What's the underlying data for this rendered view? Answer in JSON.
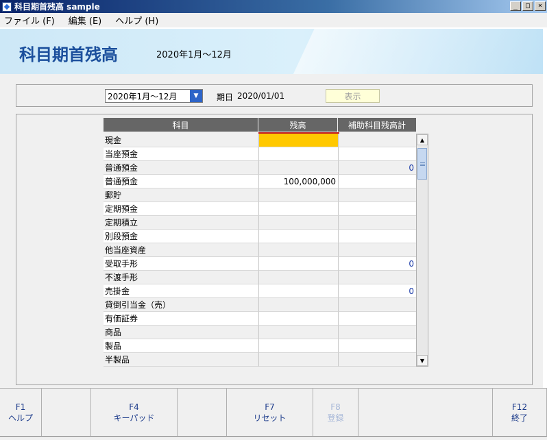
{
  "window": {
    "title": "科目期首残高 sample",
    "buttons": [
      "_",
      "□",
      "×"
    ]
  },
  "menu": [
    {
      "label": "ファイル (F)"
    },
    {
      "label": "編集 (E)"
    },
    {
      "label": "ヘルプ (H)"
    }
  ],
  "header": {
    "title": "科目期首残高",
    "period": "2020年1月〜12月"
  },
  "filter": {
    "period_select": "2020年1月〜12月",
    "start_label": "期日",
    "start_date": "2020/01/01",
    "show_button": "表示"
  },
  "table": {
    "headers": [
      "科目",
      "残高",
      "補助科目残高計"
    ],
    "rows": [
      {
        "account": "現金",
        "balance": "",
        "sub_total": ""
      },
      {
        "account": "当座預金",
        "balance": "",
        "sub_total": ""
      },
      {
        "account": "普通預金",
        "balance": "",
        "sub_total": "0"
      },
      {
        "account": "普通預金",
        "balance": "100,000,000",
        "sub_total": ""
      },
      {
        "account": "郵貯",
        "balance": "",
        "sub_total": ""
      },
      {
        "account": "定期預金",
        "balance": "",
        "sub_total": ""
      },
      {
        "account": "定期積立",
        "balance": "",
        "sub_total": ""
      },
      {
        "account": "別段預金",
        "balance": "",
        "sub_total": ""
      },
      {
        "account": "他当座資産",
        "balance": "",
        "sub_total": ""
      },
      {
        "account": "受取手形",
        "balance": "",
        "sub_total": "0"
      },
      {
        "account": "不渡手形",
        "balance": "",
        "sub_total": ""
      },
      {
        "account": "売掛金",
        "balance": "",
        "sub_total": "0"
      },
      {
        "account": "貸倒引当金（売）",
        "balance": "",
        "sub_total": ""
      },
      {
        "account": "有価証券",
        "balance": "",
        "sub_total": ""
      },
      {
        "account": "商品",
        "balance": "",
        "sub_total": ""
      },
      {
        "account": "製品",
        "balance": "",
        "sub_total": ""
      },
      {
        "account": "半製品",
        "balance": "",
        "sub_total": ""
      }
    ]
  },
  "fkeys": [
    {
      "key": "F1",
      "label": "ヘルプ",
      "enabled": true
    },
    {
      "key": "",
      "label": "",
      "enabled": true
    },
    {
      "key": "F4",
      "label": "キーパッド",
      "enabled": true
    },
    {
      "key": "",
      "label": "",
      "enabled": true
    },
    {
      "key": "F7",
      "label": "リセット",
      "enabled": true
    },
    {
      "key": "F8",
      "label": "登録",
      "enabled": false
    },
    {
      "key": "",
      "label": "",
      "enabled": true
    },
    {
      "key": "F12",
      "label": "終了",
      "enabled": true
    }
  ],
  "colors": {
    "title_text": "#1b4f9c",
    "active_cell": "#ffc800",
    "header_bg": "#666666",
    "sort_line": "#c0141a",
    "link_blue": "#1a3aa8"
  }
}
